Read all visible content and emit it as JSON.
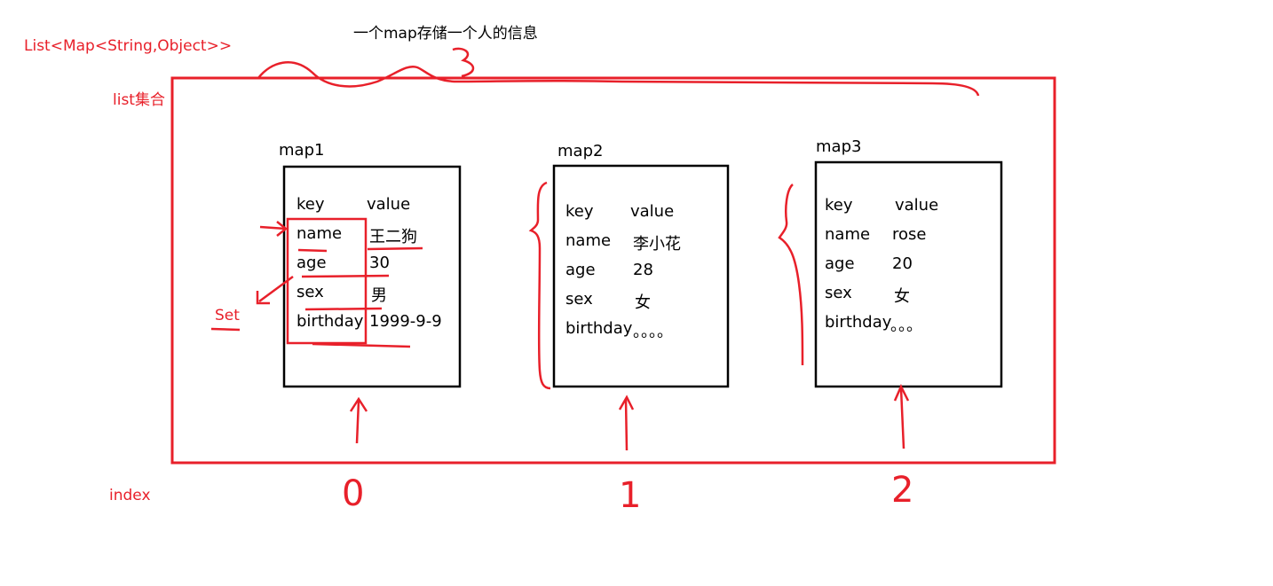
{
  "diagram": {
    "type_label": "List<Map<String,Object>>",
    "caption": "一个map存储一个人的信息",
    "list_label": "list集合",
    "set_label": "Set",
    "index_label": "index",
    "colors": {
      "annotation": "#e8202a",
      "ink": "#000000"
    },
    "maps": [
      {
        "title": "map1",
        "header": {
          "key": "key",
          "value": "value"
        },
        "entries": [
          {
            "key": "name",
            "value": "王二狗"
          },
          {
            "key": "age",
            "value": "30"
          },
          {
            "key": "sex",
            "value": "男"
          },
          {
            "key": "birthday",
            "value": "1999-9-9"
          }
        ],
        "index": "0"
      },
      {
        "title": "map2",
        "header": {
          "key": "key",
          "value": "value"
        },
        "entries": [
          {
            "key": "name",
            "value": "李小花"
          },
          {
            "key": "age",
            "value": "28"
          },
          {
            "key": "sex",
            "value": "女"
          },
          {
            "key": "birthday",
            "value": "。。。。"
          }
        ],
        "index": "1"
      },
      {
        "title": "map3",
        "header": {
          "key": "key",
          "value": "value"
        },
        "entries": [
          {
            "key": "name",
            "value": "rose"
          },
          {
            "key": "age",
            "value": "20"
          },
          {
            "key": "sex",
            "value": "女"
          },
          {
            "key": "birthday",
            "value": "。。。"
          }
        ],
        "index": "2"
      }
    ]
  }
}
